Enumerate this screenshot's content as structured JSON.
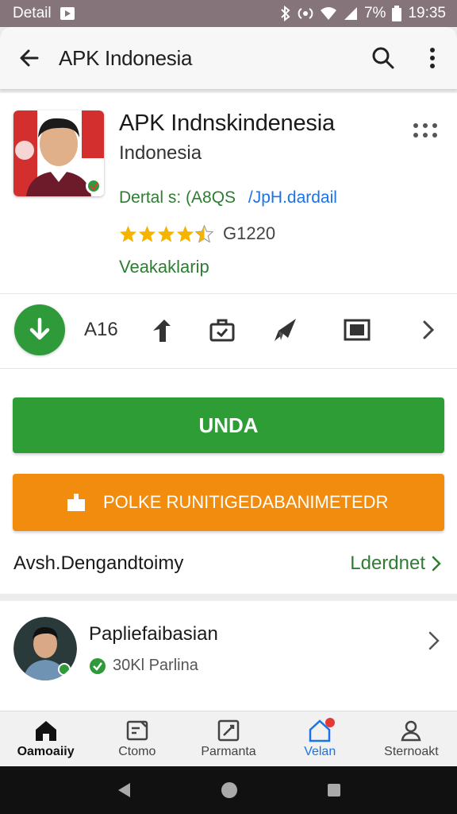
{
  "status_bar": {
    "carrier": "Detail",
    "battery": "7%",
    "time": "19:35"
  },
  "app_bar": {
    "title": "APK Indonesia",
    "icons": [
      "back-arrow-icon",
      "search-icon",
      "overflow-menu-icon"
    ]
  },
  "app": {
    "name": "APK Indnskindenesia",
    "subtitle": "Indonesia",
    "meta_label": "Dertal s: (A8QS",
    "meta_link": "/JpH.dardail",
    "rating_stars": 4.5,
    "rating_count": "G1220",
    "tag": "Veakaklarip"
  },
  "actions": {
    "download_count": "A16",
    "icons": [
      "download-icon",
      "share-icon",
      "briefcase-icon",
      "send-icon",
      "gallery-icon",
      "chevron-right-icon"
    ]
  },
  "buttons": {
    "install": "UNDA",
    "secondary": "POLKE RUNITIGEDABANIMETEDR"
  },
  "more": {
    "title": "Avsh.Dengandtoimy",
    "link": "Lderdnet"
  },
  "developer": {
    "name": "Papliefaibasian",
    "subtitle": "30Kl Parlina"
  },
  "bottom_nav": [
    {
      "label": "Oamoaiiy",
      "icon": "home-icon"
    },
    {
      "label": "Ctomo",
      "icon": "image-icon"
    },
    {
      "label": "Parmanta",
      "icon": "edit-icon"
    },
    {
      "label": "Velan",
      "icon": "house-icon"
    },
    {
      "label": "Sternoakt",
      "icon": "person-icon"
    }
  ],
  "colors": {
    "primary_green": "#2e9d36",
    "orange": "#f28c0f",
    "link_blue": "#1a73e8",
    "status_bar": "#857479"
  }
}
